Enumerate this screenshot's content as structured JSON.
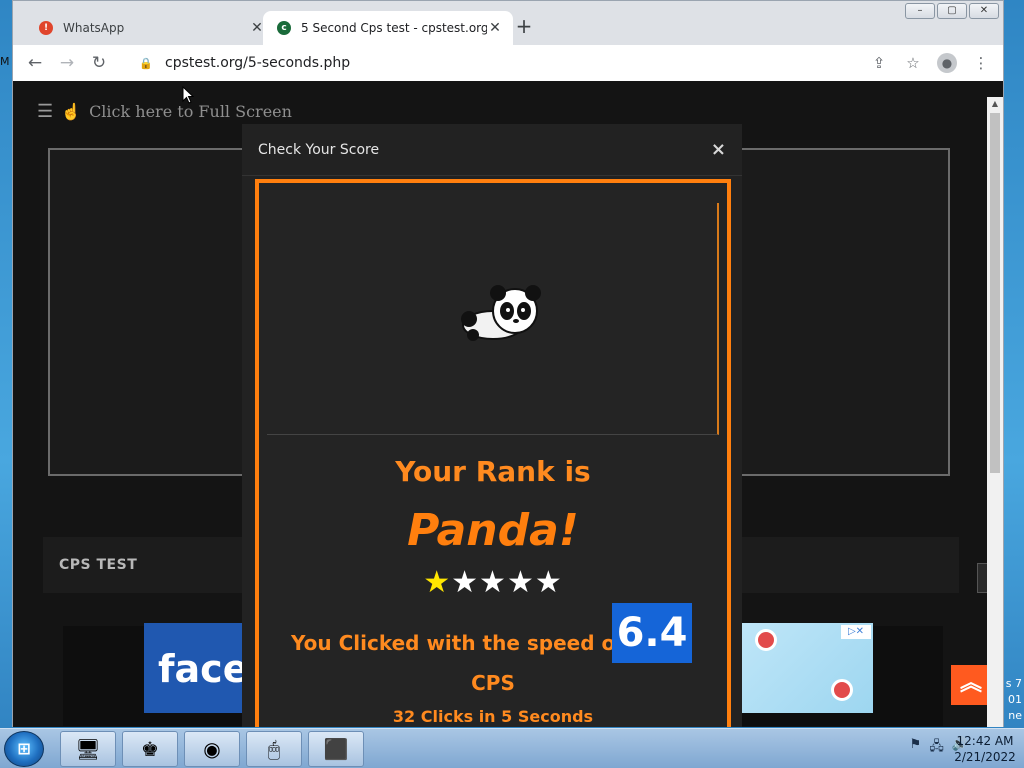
{
  "browser": {
    "tabs": [
      {
        "title": "WhatsApp",
        "close": "✕",
        "favicon": "!"
      },
      {
        "title": "5 Second Cps test - cpstest.org",
        "close": "✕",
        "favicon": "c"
      }
    ],
    "new_tab": "+",
    "address": "cpstest.org/5-seconds.php",
    "window_controls": [
      "–",
      "▢",
      "✕"
    ]
  },
  "page": {
    "fullscreen_text": "Click here to Full Screen",
    "cps_test_label": "CPS TEST",
    "ad_fb_text": "face",
    "ad_close": "▷✕"
  },
  "modal": {
    "title": "Check Your Score",
    "close": "×",
    "rank_line": "Your Rank is",
    "rank_name": "Panda!",
    "stars_filled": 1,
    "stars_total": 5,
    "speed_text": "You Clicked with the speed of",
    "speed_value": "6.4",
    "cps_label": "CPS",
    "clicks_text": "32 Clicks in 5 Seconds"
  },
  "taskbar": {
    "time": "12:42 AM",
    "date": "2/21/2022"
  },
  "colors": {
    "accent_orange": "#ff7f0e",
    "speed_blue": "#1565d8",
    "star_yellow": "#ffe600"
  }
}
